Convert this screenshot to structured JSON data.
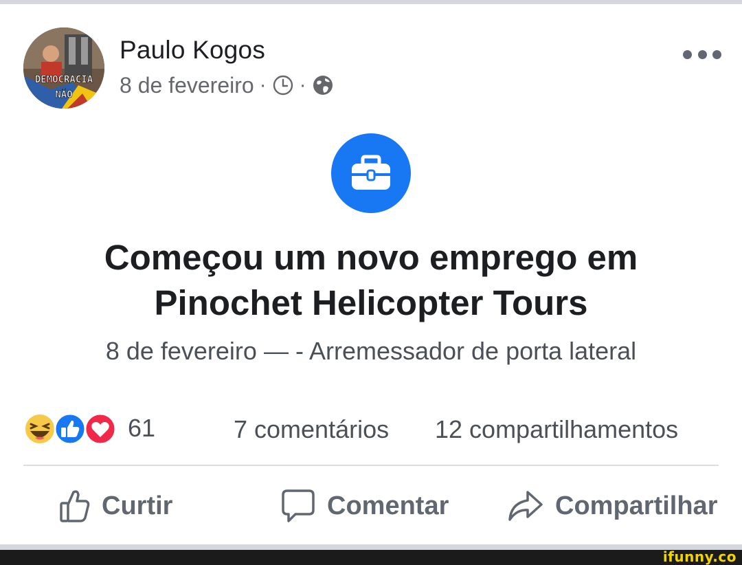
{
  "post": {
    "author": "Paulo Kogos",
    "avatar_caption_line1": "DEMOCRACIA",
    "avatar_caption_line2": "NÃO",
    "date": "8 de fevereiro",
    "separator": "·",
    "privacy_icon": "globe-icon",
    "time_icon": "clock-icon",
    "menu_icon": "more-horizontal-icon"
  },
  "life_event": {
    "icon": "briefcase-icon",
    "icon_bg_color": "#1877f2",
    "title": "Começou um novo emprego em Pinochet Helicopter Tours",
    "subtitle": "8 de fevereiro —  - Arremessador de porta lateral"
  },
  "stats": {
    "reactions": [
      "haha",
      "like",
      "love"
    ],
    "reaction_count": "61",
    "comments": "7 comentários",
    "shares": "12 compartilhamentos"
  },
  "actions": {
    "like": "Curtir",
    "comment": "Comentar",
    "share": "Compartilhar"
  },
  "watermark": "ifunny.co"
}
